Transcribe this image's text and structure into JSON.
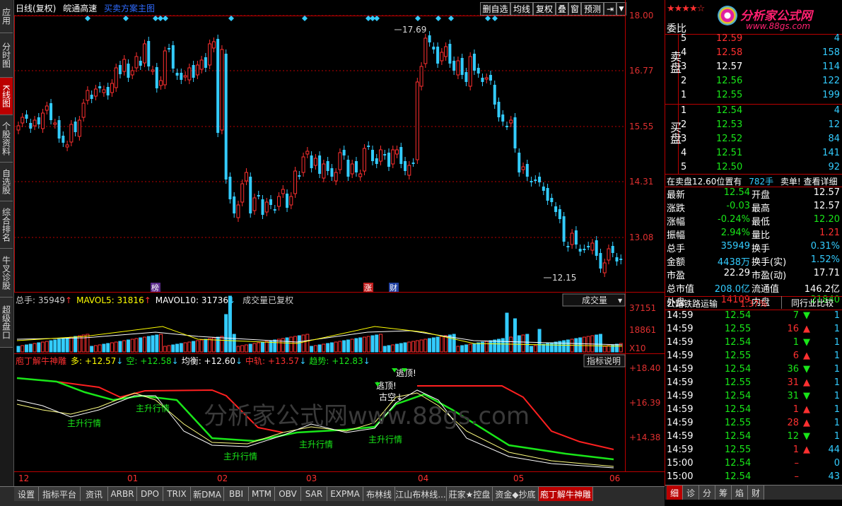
{
  "left_tabs": [
    {
      "label": "应用"
    },
    {
      "label": "分时图"
    },
    {
      "label": "K线图",
      "active": true
    },
    {
      "label": "个股资料"
    },
    {
      "label": "自选股"
    },
    {
      "label": "综合排名"
    },
    {
      "label": "牛叉诊股"
    },
    {
      "label": "超级盘口"
    }
  ],
  "header": {
    "period": "日线(复权)",
    "stock": "皖通高速",
    "formula": "买卖方案主图"
  },
  "toolbar": {
    "b1": "删自选",
    "b2": "均线",
    "b3": "复权",
    "b4": "叠",
    "b5": "窗",
    "b6": "预测"
  },
  "price_axis": [
    "18.00",
    "16.77",
    "15.55",
    "14.31",
    "13.08"
  ],
  "price_marks": {
    "high": "17.69",
    "low": "12.15"
  },
  "event_marks": {
    "m1": "榜",
    "m2": "涨",
    "m3": "财"
  },
  "volume": {
    "label": "总手: 35949↑ MAVOL5: 31816↑ MAVOL10: 31736↓ 成交量已复权",
    "label_parts": [
      "总手: 35949",
      "↑",
      "MAVOL5: 31816",
      "↑",
      "MAVOL10: 31736",
      "↓",
      "成交量已复权"
    ],
    "dropdown": "成交量",
    "axis": [
      "37151",
      "18861",
      "X10"
    ]
  },
  "indicator": {
    "name": "庖丁解牛神雕",
    "parts": [
      "多: +12.57",
      "↓",
      "空: +12.58",
      "↓",
      "均衡: +12.60",
      "↓",
      "中轨: +13.57",
      "↓",
      "趋势: +12.83",
      "↓"
    ],
    "help": "指标说明",
    "axis": [
      "+18.40",
      "+16.39",
      "+14.38"
    ],
    "labels": [
      "主升行情",
      "主升行情",
      "主升行情",
      "主升行情",
      "主升行情"
    ],
    "top_labels": [
      "逃顶!",
      "逃顶!",
      "古空↓"
    ],
    "watermark": "分析家公式网www.88gs.com"
  },
  "x_axis": [
    "12",
    "01",
    "02",
    "03",
    "04",
    "05",
    "06"
  ],
  "right": {
    "logo": "分析家公式网",
    "logo_url": "www.88gs.com",
    "weibi": "委比",
    "sell_label": "卖盘",
    "buy_label": "买盘",
    "sell": [
      [
        "5",
        "12.59",
        "4"
      ],
      [
        "4",
        "12.58",
        "158"
      ],
      [
        "3",
        "12.57",
        "114"
      ],
      [
        "2",
        "12.56",
        "122"
      ],
      [
        "1",
        "12.55",
        "199"
      ]
    ],
    "buy": [
      [
        "1",
        "12.54",
        "4"
      ],
      [
        "2",
        "12.53",
        "12"
      ],
      [
        "3",
        "12.52",
        "84"
      ],
      [
        "4",
        "12.51",
        "141"
      ],
      [
        "5",
        "12.50",
        "92"
      ]
    ],
    "info_line": "在卖盘12.60位置有",
    "info_vol": "782手",
    "info_link": "卖单! 查看详细",
    "stats": [
      [
        "最新",
        "12.54",
        "开盘",
        "12.57"
      ],
      [
        "涨跌",
        "-0.03",
        "最高",
        "12.57"
      ],
      [
        "涨幅",
        "-0.24%",
        "最低",
        "12.20"
      ],
      [
        "振幅",
        "2.94%",
        "量比",
        "1.21"
      ],
      [
        "总手",
        "35949",
        "换手",
        "0.31%"
      ],
      [
        "金额",
        "4438万",
        "换手(实)",
        "1.52%"
      ],
      [
        "市盈",
        "22.29",
        "市盈(动)",
        "17.71"
      ],
      [
        "总市值",
        "208.0亿",
        "流通值",
        "146.2亿"
      ],
      [
        "外盘",
        "14109",
        "内盘",
        "21840"
      ]
    ],
    "industry": "公路铁路运输",
    "industry_pct": "1.37%",
    "compare": "同行业比较",
    "ticks": [
      [
        "14:59",
        "12.54",
        "7",
        "down",
        "1"
      ],
      [
        "14:59",
        "12.55",
        "16",
        "up",
        "1"
      ],
      [
        "14:59",
        "12.54",
        "1",
        "down",
        "1"
      ],
      [
        "14:59",
        "12.55",
        "6",
        "up",
        "1"
      ],
      [
        "14:59",
        "12.54",
        "36",
        "down",
        "1"
      ],
      [
        "14:59",
        "12.55",
        "31",
        "up",
        "1"
      ],
      [
        "14:59",
        "12.54",
        "31",
        "down",
        "1"
      ],
      [
        "14:59",
        "12.54",
        "1",
        "up",
        "1"
      ],
      [
        "14:59",
        "12.55",
        "28",
        "up",
        "1"
      ],
      [
        "14:59",
        "12.54",
        "12",
        "down",
        "1"
      ],
      [
        "14:59",
        "12.55",
        "1",
        "up",
        "44"
      ],
      [
        "15:00",
        "12.54",
        "",
        "",
        "0"
      ],
      [
        "15:00",
        "12.54",
        "",
        "",
        "43"
      ]
    ],
    "bottom_tabs": [
      "细",
      "诊",
      "分",
      "筹",
      "焰",
      "财"
    ]
  },
  "bottom_tabs": [
    "设置",
    "指标平台",
    "资讯",
    "ARBR",
    "DPO",
    "TRIX",
    "新DMA",
    "BBI",
    "MTM",
    "OBV",
    "SAR",
    "EXPMA",
    "布林线",
    "江山布林线...",
    "莊家★控盘",
    "资金◆抄底",
    "庖丁解牛神雕"
  ]
}
